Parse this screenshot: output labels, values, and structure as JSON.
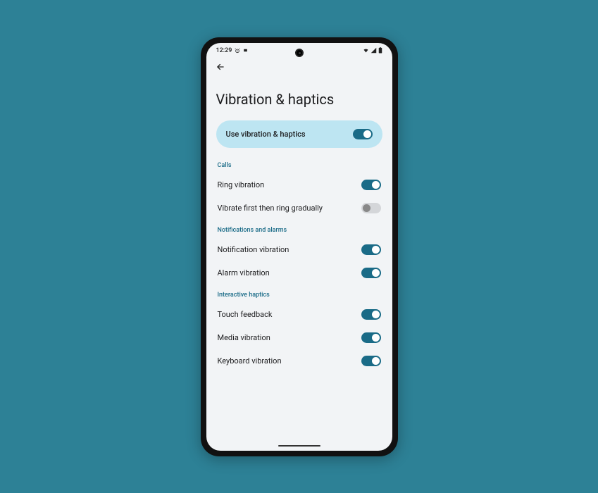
{
  "statusbar": {
    "time": "12:29",
    "icons_left": "alarm",
    "icons_right": "wifi signal battery"
  },
  "page": {
    "title": "Vibration & haptics"
  },
  "master": {
    "label": "Use vibration & haptics",
    "on": true
  },
  "sections": [
    {
      "header": "Calls",
      "items": [
        {
          "label": "Ring vibration",
          "on": true
        },
        {
          "label": "Vibrate first then ring gradually",
          "on": false
        }
      ]
    },
    {
      "header": "Notifications and alarms",
      "items": [
        {
          "label": "Notification vibration",
          "on": true
        },
        {
          "label": "Alarm vibration",
          "on": true
        }
      ]
    },
    {
      "header": "Interactive haptics",
      "items": [
        {
          "label": "Touch feedback",
          "on": true
        },
        {
          "label": "Media vibration",
          "on": true
        },
        {
          "label": "Keyboard vibration",
          "on": true
        }
      ]
    }
  ]
}
